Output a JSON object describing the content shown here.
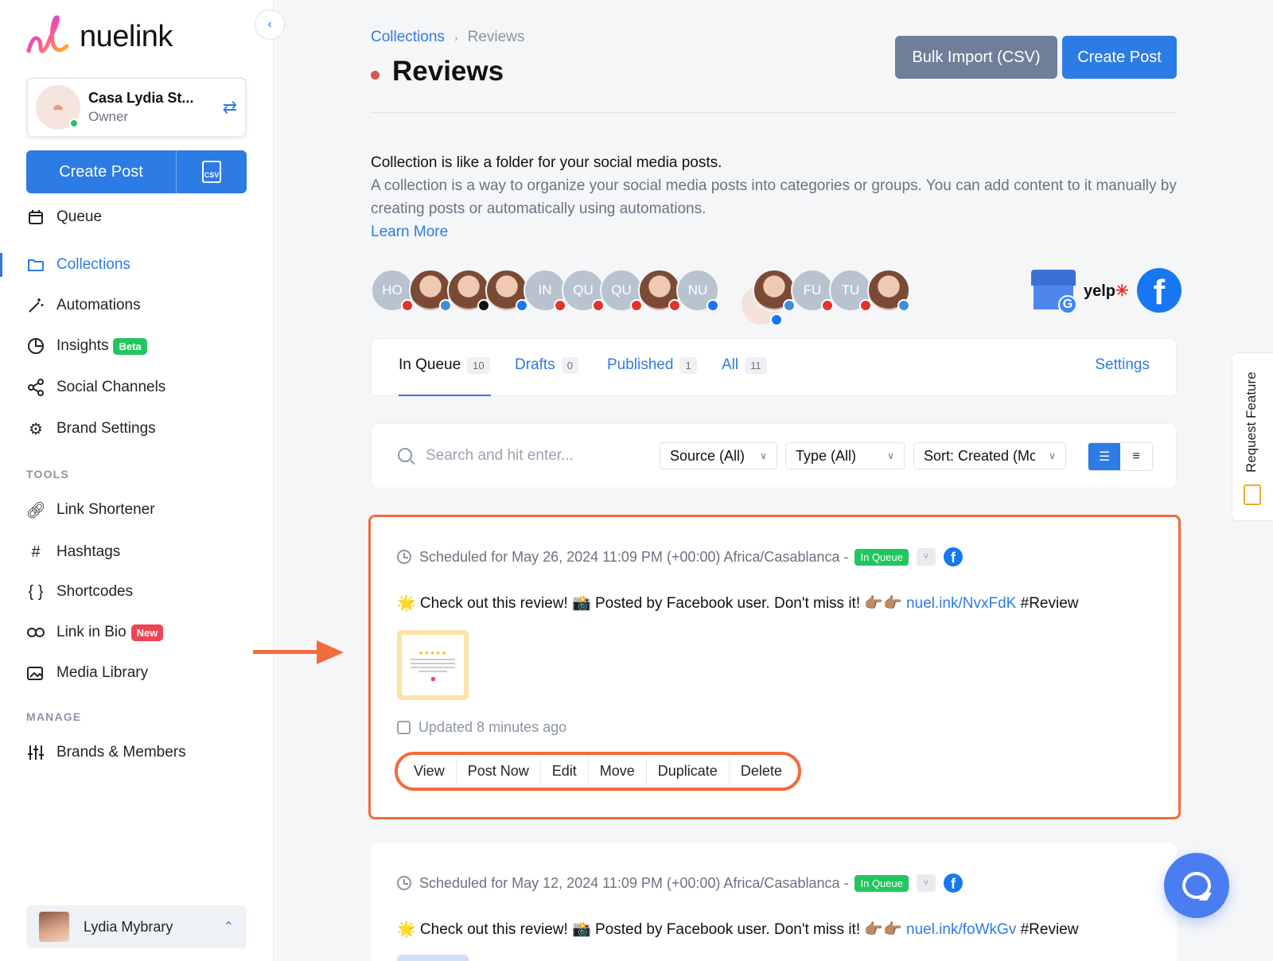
{
  "app": {
    "logo_text": "nuelink",
    "account_name": "Casa Lydia St...",
    "account_role": "Owner"
  },
  "sidebar": {
    "create_label": "Create Post",
    "csv_label": "CSV",
    "nav": {
      "queue": "Queue",
      "collections": "Collections",
      "automations": "Automations",
      "insights": "Insights",
      "insights_badge": "Beta",
      "social_channels": "Social Channels",
      "brand_settings": "Brand Settings"
    },
    "tools_title": "TOOLS",
    "tools": {
      "link_shortener": "Link Shortener",
      "hashtags": "Hashtags",
      "shortcodes": "Shortcodes",
      "link_in_bio": "Link in Bio",
      "link_in_bio_badge": "New",
      "media_library": "Media Library"
    },
    "manage_title": "MANAGE",
    "manage": {
      "brands_members": "Brands & Members"
    },
    "user_name": "Lydia Mybrary"
  },
  "header": {
    "breadcrumb_root": "Collections",
    "breadcrumb_current": "Reviews",
    "title": "Reviews",
    "bulk_import": "Bulk Import (CSV)",
    "create_post": "Create Post"
  },
  "description": {
    "line1": "Collection is like a folder for your social media posts.",
    "line2": "A collection is a way to organize your social media posts into categories or groups. You can add content to it manually by creating posts or automatically using automations.",
    "learn_more": "Learn More"
  },
  "channel_avatars": {
    "initials": [
      "HO",
      "IN",
      "QU",
      "QU",
      "NU",
      "FU",
      "TU"
    ]
  },
  "brand_logos": {
    "yelp": "yelp",
    "google_g": "G",
    "facebook_f": "f"
  },
  "tabs": {
    "in_queue": "In Queue",
    "in_queue_count": "10",
    "drafts": "Drafts",
    "drafts_count": "0",
    "published": "Published",
    "published_count": "1",
    "all": "All",
    "all_count": "11",
    "settings": "Settings"
  },
  "filters": {
    "search_placeholder": "Search and hit enter...",
    "source": "Source (All)",
    "type": "Type (All)",
    "sort": "Sort: Created (Mo"
  },
  "posts": [
    {
      "schedule": "Scheduled for May 26, 2024 11:09 PM (+00:00) Africa/Casablanca -",
      "status": "In Queue",
      "text_before": "🌟 Check out this review! 📸 Posted by Facebook user. Don't miss it! 👉🏽👉🏽 ",
      "link": "nuel.ink/NvxFdK",
      "text_after": " #Review",
      "updated": "Updated 8 minutes ago",
      "actions": [
        "View",
        "Post Now",
        "Edit",
        "Move",
        "Duplicate",
        "Delete"
      ]
    },
    {
      "schedule": "Scheduled for May 12, 2024 11:09 PM (+00:00) Africa/Casablanca -",
      "status": "In Queue",
      "text_before": "🌟 Check out this review! 📸 Posted by Facebook user. Don't miss it! 👉🏽👉🏽 ",
      "link": "nuel.ink/foWkGv",
      "text_after": " #Review"
    }
  ],
  "request_feature": "Request Feature",
  "colors": {
    "accent": "#2d7be5",
    "highlight": "#f26b3a",
    "success": "#22c55e",
    "danger": "#ef4453"
  }
}
